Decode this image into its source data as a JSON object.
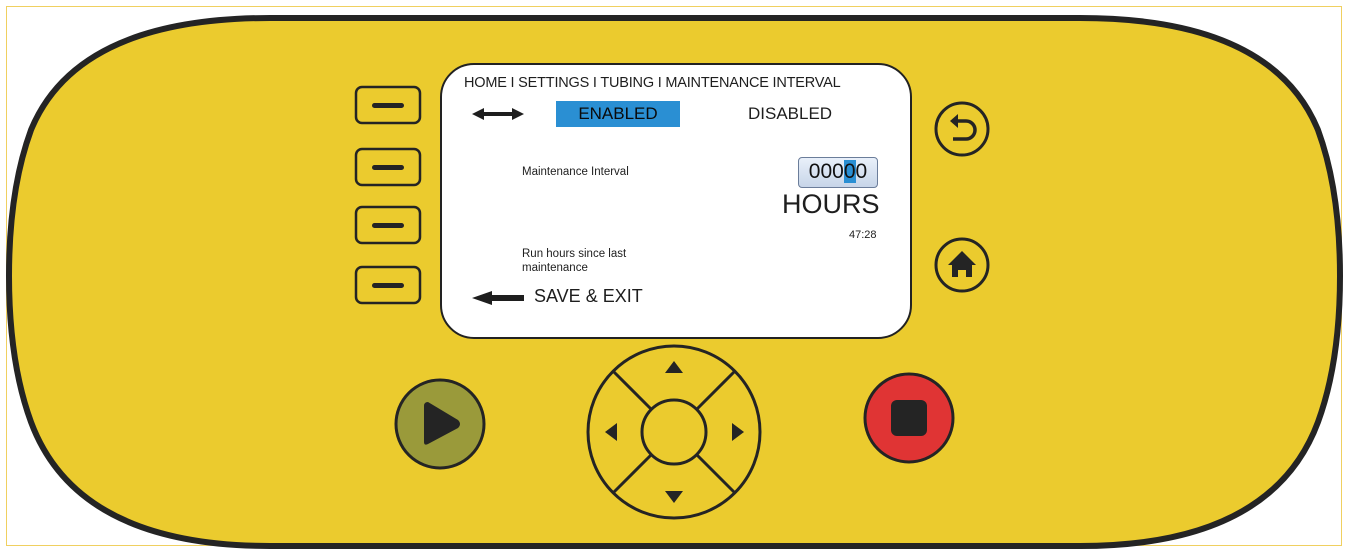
{
  "screen": {
    "breadcrumb": "HOME I SETTINGS I TUBING I MAINTENANCE INTERVAL",
    "options": {
      "enabled": "ENABLED",
      "disabled": "DISABLED",
      "selected": "enabled"
    },
    "maintenance_label": "Maintenance Interval",
    "interval_value_prefix": "000",
    "interval_value_cursor": "0",
    "interval_value_suffix": "0",
    "units": "HOURS",
    "run_hours_label_line1": "Run hours since last",
    "run_hours_label_line2": "maintenance",
    "run_hours_value": "47:28",
    "save_exit": "SAVE & EXIT"
  },
  "colors": {
    "body": "#ebcb2e",
    "highlight": "#2a8fd3",
    "play_button": "#9a9a3a",
    "stop_button": "#e03434",
    "outline": "#222222"
  },
  "icons": {
    "back": "back-arrow-icon",
    "home": "home-icon",
    "play": "play-icon",
    "stop": "stop-icon",
    "up": "up-arrow-icon",
    "down": "down-arrow-icon",
    "left": "left-arrow-icon",
    "right": "right-arrow-icon"
  }
}
